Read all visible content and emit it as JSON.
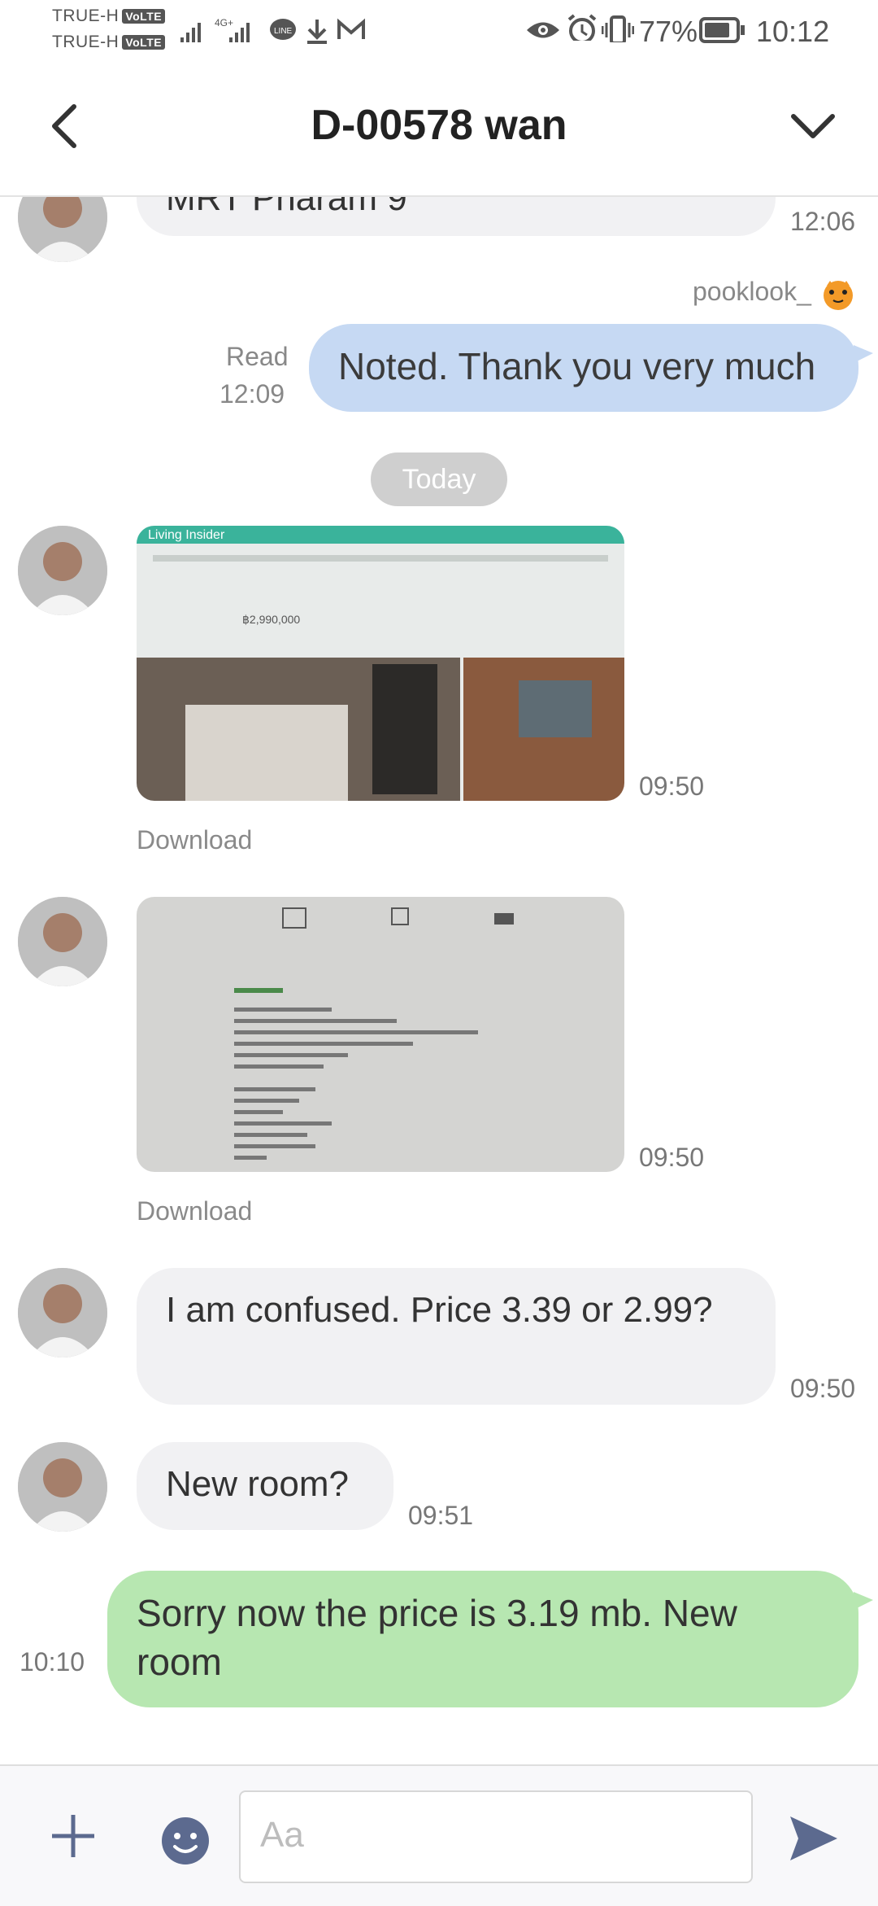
{
  "status_bar": {
    "carrier_1": "TRUE-H",
    "carrier_2": "TRUE-H",
    "volte_badge": "VoLTE",
    "network_type": "4G+",
    "battery": "77%",
    "time": "10:12",
    "icons": [
      "signal-icon",
      "line-icon",
      "download-icon",
      "gmail-icon",
      "eye-icon",
      "alarm-icon",
      "vibrate-icon",
      "battery-icon"
    ]
  },
  "header": {
    "title": "D-00578 wan",
    "back_icon": "chevron-left-icon",
    "menu_icon": "chevron-down-icon"
  },
  "messages": {
    "m0": {
      "text": "MRT Pharam 9",
      "time": "12:06"
    },
    "m1": {
      "sender": "pooklook_",
      "read_label": "Read",
      "time": "12:09",
      "text": "Noted. Thank you very much"
    },
    "date_divider": "Today",
    "m2": {
      "time": "09:50",
      "download": "Download",
      "photo_brand": "Living Insider",
      "photo_price": "฿2,990,000"
    },
    "m3": {
      "time": "09:50",
      "download": "Download"
    },
    "m4": {
      "text": "I am confused. Price 3.39 or 2.99?",
      "time": "09:50"
    },
    "m5": {
      "text": "New room?",
      "time": "09:51"
    },
    "m6": {
      "text": "Sorry now the price is 3.19 mb. New room",
      "time": "10:10"
    }
  },
  "input_bar": {
    "placeholder": "Aa",
    "plus_icon": "plus-icon",
    "emoji_icon": "emoji-icon",
    "send_icon": "send-icon"
  },
  "colors": {
    "incoming_bubble": "#f1f1f3",
    "outgoing_blue": "#c6d9f3",
    "outgoing_green": "#b7e7b1",
    "accent": "#5c6a8f"
  }
}
